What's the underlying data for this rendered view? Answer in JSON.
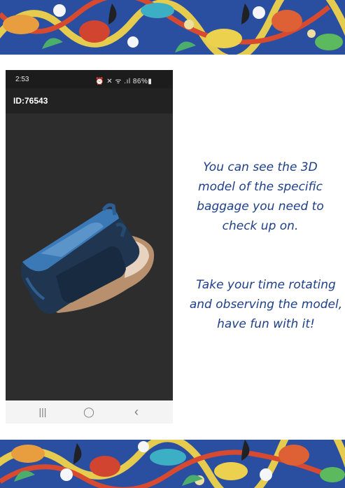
{
  "status_bar": {
    "time": "2:53",
    "icons_text": "⏰ ✕ ᯤ .ıl 86%▮",
    "battery": "86%"
  },
  "app_bar": {
    "title": "ID:76543"
  },
  "viewer": {
    "content": "3d-baggage-model"
  },
  "nav_bar": {
    "recents_icon": "|||",
    "home_icon": "◯",
    "back_icon": "‹"
  },
  "captions": {
    "first": "You can see the 3D model of the specific baggage you need to check up on.",
    "second": "Take your time rotating and observing the model, have fun with it!"
  },
  "colors": {
    "caption_text": "#1e3f87",
    "batik_background": "#2a4fa0",
    "phone_background": "#2b2b2b"
  }
}
